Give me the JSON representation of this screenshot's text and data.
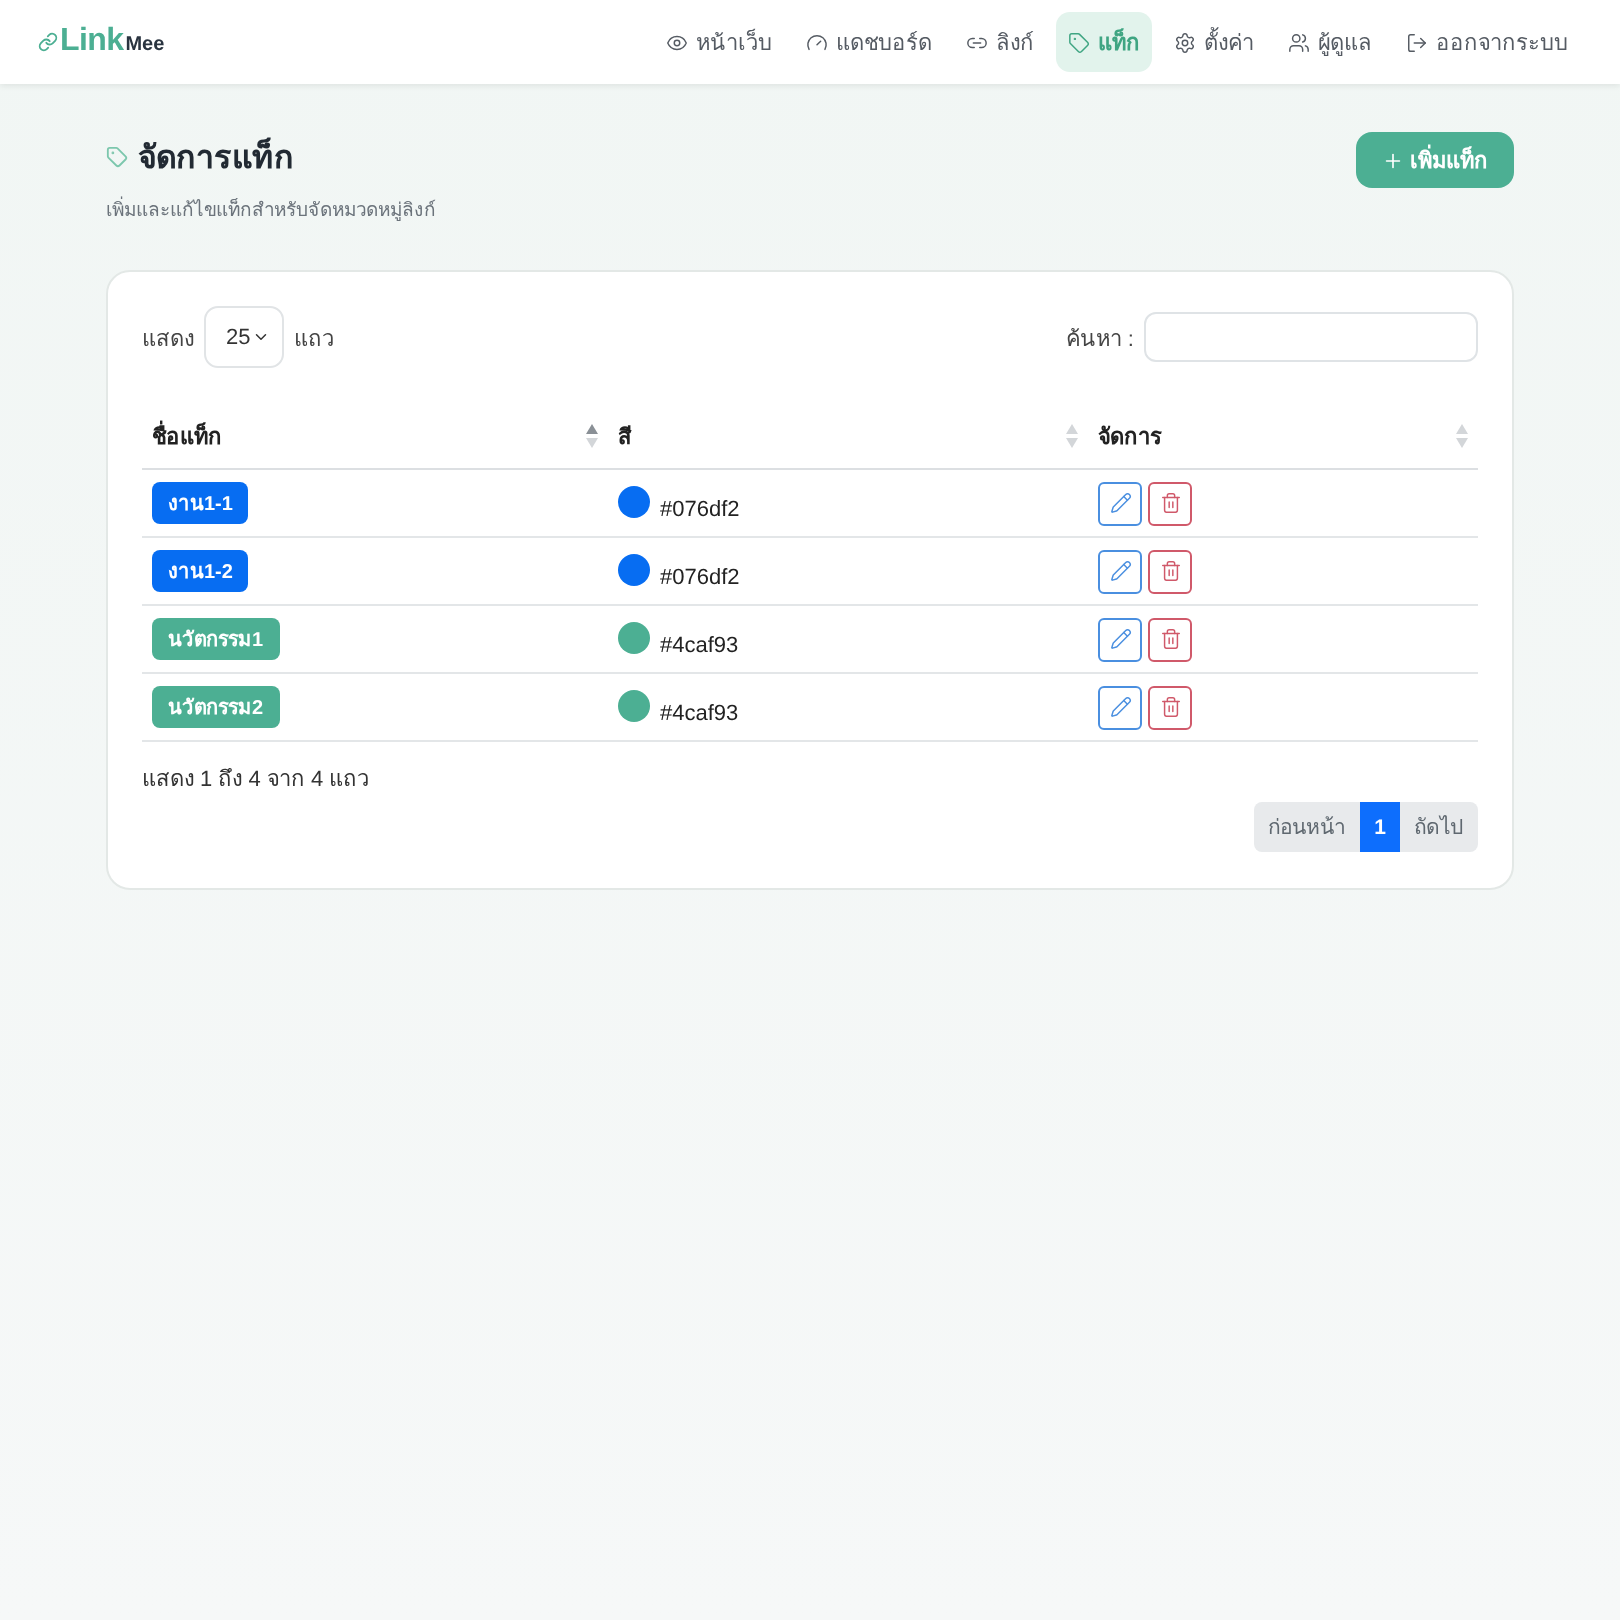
{
  "navbar": {
    "brand": {
      "primary": "Link",
      "secondary": "Mee"
    },
    "items": [
      {
        "label": "หน้าเว็บ",
        "selected": false
      },
      {
        "label": "แดชบอร์ด",
        "selected": false
      },
      {
        "label": "ลิงก์",
        "selected": false
      },
      {
        "label": "แท็ก",
        "selected": true
      },
      {
        "label": "ตั้งค่า",
        "selected": false
      },
      {
        "label": "ผู้ดูแล",
        "selected": false
      },
      {
        "label": "ออกจากระบบ",
        "selected": false
      }
    ]
  },
  "page_header": {
    "title": "จัดการแท็ก",
    "subtitle": "เพิ่มและแก้ไขแท็กสำหรับจัดหมวดหมู่ลิงก์",
    "add_button": "เพิ่มแท็ก"
  },
  "table_card": {
    "length_menu": {
      "label_before": "แสดง",
      "value": "25",
      "label_after": "แถว"
    },
    "search": {
      "label": "ค้นหา :"
    },
    "columns": [
      {
        "label": "ชื่อแท็ก",
        "sorted": true
      },
      {
        "label": "สี",
        "sorted": false
      },
      {
        "label": "จัดการ",
        "sorted": false
      }
    ],
    "rows": [
      {
        "name": "งาน1-1",
        "color": "#076df2",
        "hex": "#076df2"
      },
      {
        "name": "งาน1-2",
        "color": "#076df2",
        "hex": "#076df2"
      },
      {
        "name": "นวัตกรรม1",
        "color": "#4caf93",
        "hex": "#4caf93"
      },
      {
        "name": "นวัตกรรม2",
        "color": "#4caf93",
        "hex": "#4caf93"
      }
    ],
    "info": "แสดง 1 ถึง 4 จาก 4 แถว",
    "pagination": [
      {
        "label": "ก่อนหน้า",
        "selected": false,
        "disabled": true
      },
      {
        "label": "1",
        "selected": true,
        "disabled": false
      },
      {
        "label": "ถัดไป",
        "selected": false,
        "disabled": true
      }
    ]
  }
}
